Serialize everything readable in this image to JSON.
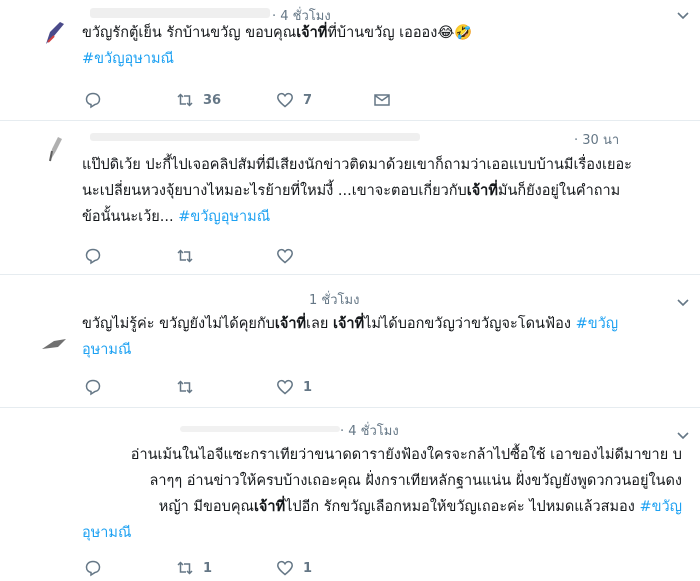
{
  "tweets": [
    {
      "time": "· 4 ชั่วโมง",
      "line1_pre": "ขวัญรักตู้เย็น รักบ้านขวัญ ขอบคุณ",
      "line1_bold": "เจ้าที่",
      "line1_post": "ที่บ้านขวัญ เอออง😂🤣",
      "hashtag": "#ขวัญอุษามณี",
      "reply_count": "",
      "retweet_count": "36",
      "like_count": "7"
    },
    {
      "time": "· 30 นา",
      "line1": "แป๊ปดิเว้ย ปะกี้ไปเจอคลิปสัมที่มีเสียงนักข่าวติดมาด้วยเขาก็ถามว่าเออแบบบ้านมีเรื่องเยอะ",
      "line2_pre": "นะเปลี่ยนหวงจุ้ยบางไหมอะไรย้ายที่ใหม่งี้ ...เขาจะตอบเกี่ยวกับ",
      "line2_bold": "เจ้าที่",
      "line2_post": "มันก็ยังอยู่ในคำถาม",
      "line3": "ข้อนั้นนะเว้ย... ",
      "hashtag": "#ขวัญอุษามณี",
      "reply_count": "",
      "retweet_count": "",
      "like_count": ""
    },
    {
      "time": "1 ชั่วโมง",
      "seg1": "ขวัญไม่รู้ค่ะ ขวัญยังไม่ได้คุยกับ",
      "bold1": "เจ้าที่",
      "seg2": "เลย ",
      "bold2": "เจ้าที่",
      "seg3": "ไม่ได้บอกขวัญว่าขวัญจะโดนฟ้อง ",
      "hashtag_a": "#ขวัญ",
      "hashtag_b": "อุษามณี",
      "reply_count": "",
      "retweet_count": "",
      "like_count": "1"
    },
    {
      "time": "· 4 ชั่วโมง",
      "line1": "อ่านเม้นในไอจีแซะกราเทียว่าขนาดดารายังฟ้องใครจะกล้าไปซื้อใช้ เอาของไม่ดีมาขาย บ",
      "line2": "ลาๆๆ อ่านข่าวให้ครบบ้างเถอะคุณ ฝั่งกราเทียหลักฐานแน่น ฝั่งขวัญยังพูดวกวนอยู่ในดง",
      "line3_pre": "หญ้า มีขอบคุณ",
      "line3_bold": "เจ้าที่",
      "line3_post": "ไปอีก รักขวัญเลือกหมอให้ขวัญเถอะค่ะ ไปหมดแล้วสมอง ",
      "hashtag_a": "#ขวัญ",
      "hashtag_b": "อุษามณี",
      "reply_count": "",
      "retweet_count": "1",
      "like_count": "1"
    }
  ],
  "colors": {
    "hashtag": "#1da1f2",
    "icon": "#657786",
    "separator": "#e6ecf0"
  },
  "icons": [
    "reply-icon",
    "retweet-icon",
    "like-icon",
    "dm-icon",
    "chevron-down-icon"
  ]
}
